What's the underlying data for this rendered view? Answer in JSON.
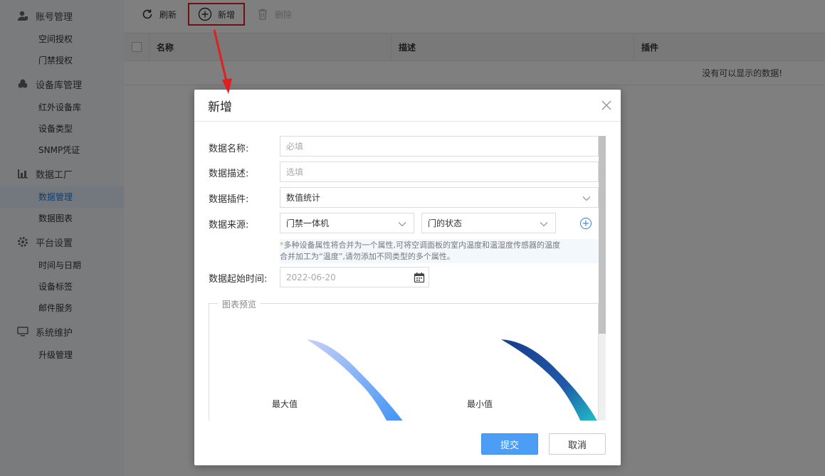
{
  "sidebar": {
    "groups": [
      {
        "label": "账号管理",
        "icon": "user-icon",
        "items": [
          "空间授权",
          "门禁授权"
        ]
      },
      {
        "label": "设备库管理",
        "icon": "devices-icon",
        "items": [
          "红外设备库",
          "设备类型",
          "SNMP凭证"
        ]
      },
      {
        "label": "数据工厂",
        "icon": "chart-icon",
        "items": [
          "数据管理",
          "数据图表"
        ]
      },
      {
        "label": "平台设置",
        "icon": "gear-icon",
        "items": [
          "时间与日期",
          "设备标签",
          "邮件服务"
        ]
      },
      {
        "label": "系统维护",
        "icon": "monitor-icon",
        "items": [
          "升级管理"
        ]
      }
    ],
    "active_item": "数据管理"
  },
  "toolbar": {
    "refresh": "刷新",
    "add": "新增",
    "delete": "删除"
  },
  "grid": {
    "columns": [
      "名称",
      "描述",
      "插件"
    ],
    "empty_text": "没有可以显示的数据!"
  },
  "dialog": {
    "title": "新增",
    "fields": {
      "name_label": "数据名称:",
      "name_placeholder": "必填",
      "desc_label": "数据描述:",
      "desc_placeholder": "选填",
      "plugin_label": "数据插件:",
      "plugin_value": "数值统计",
      "source_label": "数据来源:",
      "source_device": "门禁一体机",
      "source_attr": "门的状态",
      "hint_star": "*",
      "hint_line1": "多种设备属性将合并为一个属性,可将空调面板的室内温度和温湿度传感器的温度",
      "hint_line2": "合并加工为“温度”,请勿添加不同类型的多个属性。",
      "start_label": "数据起始时间:",
      "start_value": "2022-06-20"
    },
    "preview": {
      "legend": "图表预览",
      "max_label": "最大值",
      "min_label": "最小值"
    },
    "buttons": {
      "submit": "提交",
      "cancel": "取消"
    }
  },
  "colors": {
    "primary": "#4b9df5",
    "annotation": "#e02020",
    "gauge_max_from": "#b6c6f7",
    "gauge_max_to": "#3d92f5",
    "gauge_min_from": "#163d8c",
    "gauge_min_to": "#20c9c9"
  }
}
